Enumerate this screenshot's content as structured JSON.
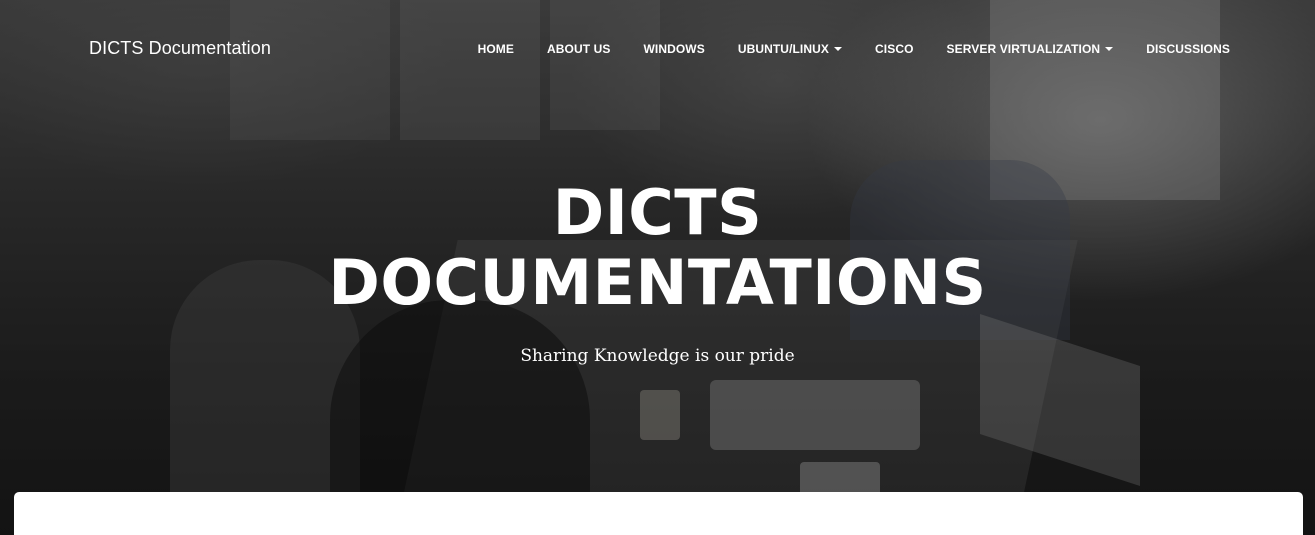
{
  "brand": "DICTS Documentation",
  "nav": {
    "items": [
      {
        "label": "HOME",
        "dropdown": false
      },
      {
        "label": "ABOUT US",
        "dropdown": false
      },
      {
        "label": "WINDOWS",
        "dropdown": false
      },
      {
        "label": "UBUNTU/LINUX",
        "dropdown": true
      },
      {
        "label": "CISCO",
        "dropdown": false
      },
      {
        "label": "SERVER VIRTUALIZATION",
        "dropdown": true
      },
      {
        "label": "DISCUSSIONS",
        "dropdown": false
      }
    ]
  },
  "hero": {
    "title_line1": "DICTS",
    "title_line2": "DOCUMENTATIONS",
    "subtitle": "Sharing Knowledge is our pride"
  },
  "colors": {
    "text": "#ffffff",
    "card": "#ffffff"
  }
}
